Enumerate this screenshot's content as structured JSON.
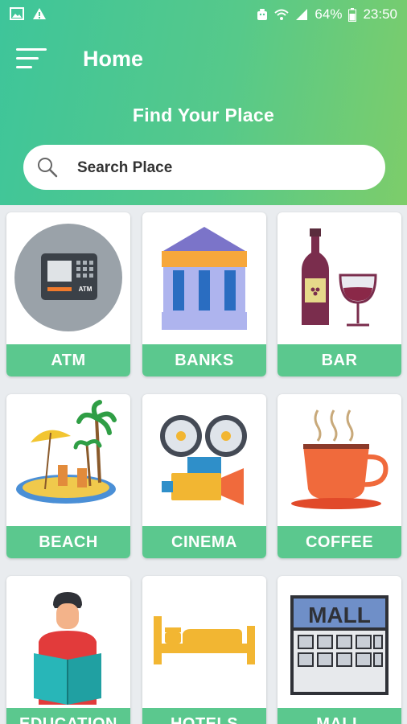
{
  "status_bar": {
    "battery": "64%",
    "time": "23:50"
  },
  "header": {
    "title": "Home",
    "subtitle": "Find Your Place"
  },
  "search": {
    "placeholder": "Search Place"
  },
  "categories": [
    {
      "label": "ATM",
      "icon": "atm-icon"
    },
    {
      "label": "BANKS",
      "icon": "bank-icon"
    },
    {
      "label": "BAR",
      "icon": "wine-icon"
    },
    {
      "label": "BEACH",
      "icon": "beach-icon"
    },
    {
      "label": "CINEMA",
      "icon": "film-camera-icon"
    },
    {
      "label": "COFFEE",
      "icon": "coffee-cup-icon"
    },
    {
      "label": "EDUCATION",
      "icon": "reader-icon"
    },
    {
      "label": "HOTELS",
      "icon": "bed-icon"
    },
    {
      "label": "MALL",
      "icon": "mall-building-icon"
    }
  ],
  "colors": {
    "header_start": "#3ec59a",
    "header_end": "#7dcd6a",
    "label_bg": "#5bc88e"
  }
}
